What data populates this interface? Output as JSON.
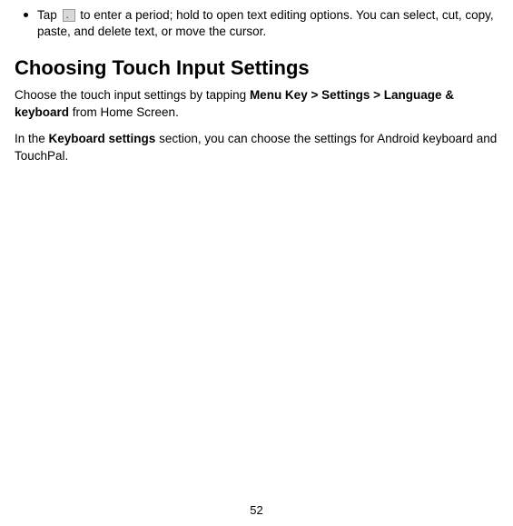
{
  "bullet": {
    "prefix": "Tap ",
    "icon_name": "period-key-icon",
    "suffix": " to enter a period; hold to open text editing options. You can select, cut, copy, paste, and delete text, or move the cursor."
  },
  "heading": "Choosing Touch Input Settings",
  "para1": {
    "text_before": "Choose the touch input settings by tapping ",
    "bold1": "Menu Key > Settings > Language & keyboard",
    "text_after": " from Home Screen."
  },
  "para2": {
    "text_before": "In the ",
    "bold1": "Keyboard settings",
    "text_after": " section, you can choose the settings for Android keyboard and TouchPal."
  },
  "page_number": "52"
}
